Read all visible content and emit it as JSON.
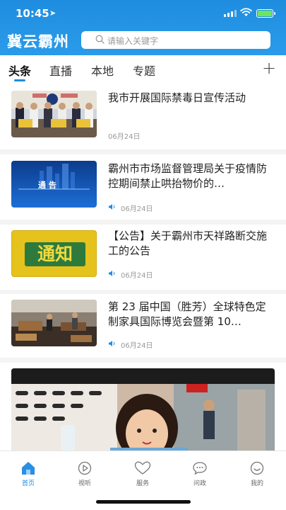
{
  "status_bar": {
    "time": "10:45"
  },
  "header": {
    "brand": "冀云霸州",
    "search_placeholder": "请输入关键字"
  },
  "tabs": [
    {
      "label": "头条",
      "active": true
    },
    {
      "label": "直播",
      "active": false
    },
    {
      "label": "本地",
      "active": false
    },
    {
      "label": "专题",
      "active": false
    }
  ],
  "feed": [
    {
      "title": "我市开展国际禁毒日宣传活动",
      "date": "06月24日",
      "has_audio": false
    },
    {
      "title": "霸州市市场监督管理局关于疫情防控期间禁止哄抬物价的…",
      "date": "06月24日",
      "has_audio": true,
      "thumb_text": "通  告"
    },
    {
      "title": "【公告】关于霸州市天祥路断交施工的公告",
      "date": "06月24日",
      "has_audio": true,
      "thumb_text": "通知"
    },
    {
      "title": "第 23 届中国（胜芳）全球特色定制家具国际博览会暨第 10…",
      "date": "06月24日",
      "has_audio": true
    }
  ],
  "bottom_nav": [
    {
      "label": "首页",
      "icon": "home-icon",
      "active": true
    },
    {
      "label": "视听",
      "icon": "play-icon",
      "active": false
    },
    {
      "label": "服务",
      "icon": "heart-icon",
      "active": false
    },
    {
      "label": "问政",
      "icon": "chat-icon",
      "active": false
    },
    {
      "label": "我的",
      "icon": "profile-icon",
      "active": false
    }
  ],
  "colors": {
    "brand_blue": "#1f8ddf",
    "notice_yellow": "#e6c21c",
    "notice_green": "#2d7a3c"
  }
}
